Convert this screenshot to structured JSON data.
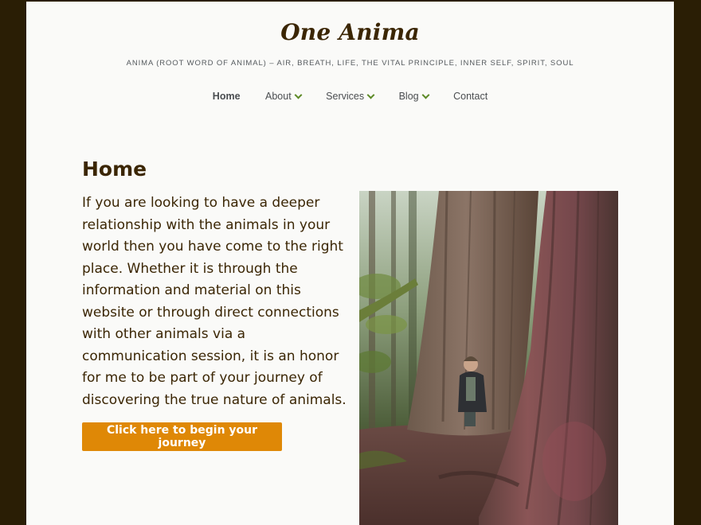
{
  "site": {
    "title": "One Anima",
    "tagline": "ANIMA (ROOT WORD OF ANIMAL) – AIR, BREATH, LIFE, THE VITAL PRINCIPLE, INNER SELF, SPIRIT, SOUL"
  },
  "nav": {
    "home": "Home",
    "about": "About",
    "services": "Services",
    "blog": "Blog",
    "contact": "Contact"
  },
  "main": {
    "heading": "Home",
    "intro": "If you are looking to have a deeper relationship with the animals in your world then you have come to the right place. Whether it is through the information and material on this website or through direct connections with other animals via a communication session, it is an honor for me to be part of your journey of discovering the true nature of animals.",
    "cta_label": "Click here to begin your journey"
  },
  "colors": {
    "background": "#2a1e05",
    "page": "#fafaf8",
    "text": "#3b2604",
    "accent": "#df8806",
    "chevron": "#5d8a27"
  },
  "icons": {
    "nav_dropdown": "chevron-down-icon"
  }
}
